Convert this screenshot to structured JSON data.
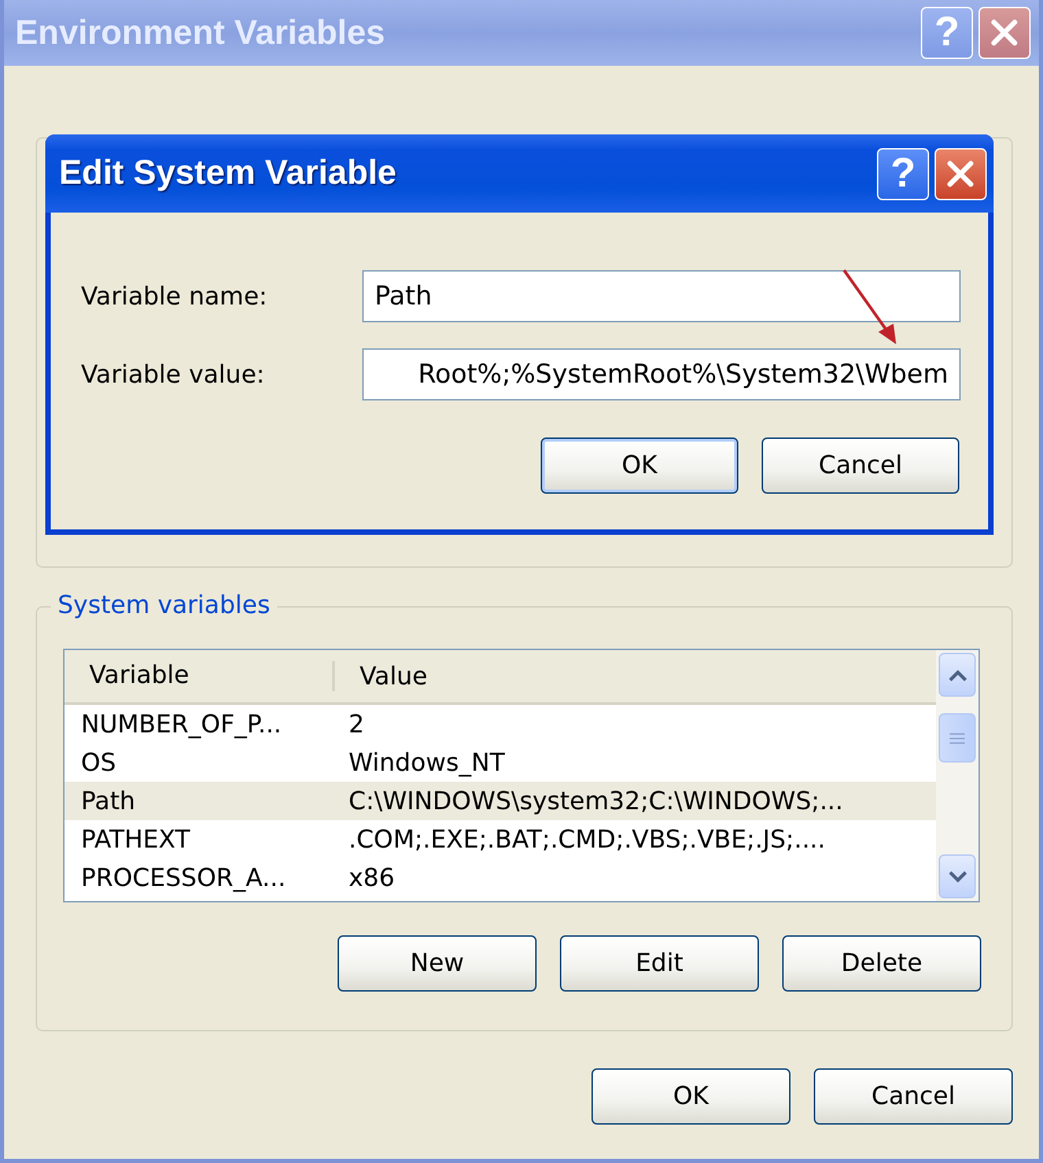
{
  "window": {
    "title": "Environment Variables",
    "active": false,
    "title_buttons": [
      {
        "kind": "help",
        "label": "?"
      },
      {
        "kind": "close"
      }
    ]
  },
  "dialog": {
    "title": "Edit System Variable",
    "active": true,
    "title_buttons": [
      {
        "kind": "help",
        "label": "?"
      },
      {
        "kind": "close"
      }
    ],
    "fields": [
      {
        "label": "Variable name:",
        "value": "Path",
        "kind": "plain"
      },
      {
        "label": "Variable value:",
        "value": "Root%;%SystemRoot%\\System32\\Wbem",
        "kind": "scrolled"
      }
    ],
    "buttons": [
      {
        "label": "OK",
        "default": true
      },
      {
        "label": "Cancel",
        "default": false
      }
    ]
  },
  "system_variables": {
    "title": "System variables",
    "columns": [
      "Variable",
      "Value"
    ],
    "rows": [
      {
        "variable": "NUMBER_OF_P...",
        "value": "2",
        "selected": false
      },
      {
        "variable": "OS",
        "value": "Windows_NT",
        "selected": false
      },
      {
        "variable": "Path",
        "value": "C:\\WINDOWS\\system32;C:\\WINDOWS;...",
        "selected": true
      },
      {
        "variable": "PATHEXT",
        "value": ".COM;.EXE;.BAT;.CMD;.VBS;.VBE;.JS;....",
        "selected": false
      },
      {
        "variable": "PROCESSOR_A...",
        "value": "x86",
        "selected": false
      }
    ],
    "buttons": [
      "New",
      "Edit",
      "Delete"
    ]
  },
  "buttons": [
    "OK",
    "Cancel"
  ]
}
